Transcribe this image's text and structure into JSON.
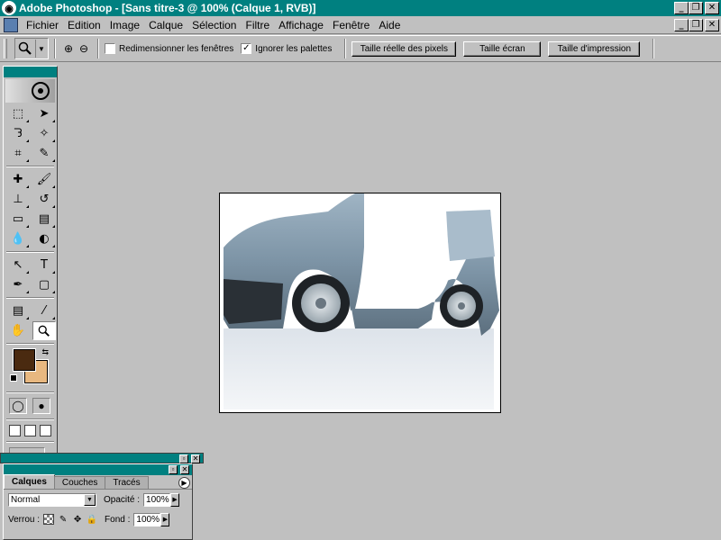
{
  "window": {
    "title": "Adobe Photoshop - [Sans titre-3 @ 100% (Calque 1, RVB)]",
    "app_icon_glyph": "◉",
    "buttons": {
      "minimize": "_",
      "restore": "❐",
      "close": "✕"
    }
  },
  "menubar": {
    "items": [
      "Fichier",
      "Edition",
      "Image",
      "Calque",
      "Sélection",
      "Filtre",
      "Affichage",
      "Fenêtre",
      "Aide"
    ]
  },
  "options": {
    "zoom_in_icon": "⊕",
    "zoom_out_icon": "⊖",
    "checkbox_resize": {
      "label": "Redimensionner les fenêtres",
      "checked": false,
      "mark": ""
    },
    "checkbox_ignore": {
      "label": "Ignorer les palettes",
      "checked": true,
      "mark": "✓"
    },
    "buttons": [
      "Taille réelle des pixels",
      "Taille écran",
      "Taille d'impression"
    ]
  },
  "toolbox": {
    "colors": {
      "foreground": "#4a2a10",
      "background": "#e8b880"
    }
  },
  "layers_palette": {
    "tabs": [
      "Calques",
      "Couches",
      "Tracés"
    ],
    "active_tab": "Calques",
    "blend_mode": "Normal",
    "opacity_label": "Opacité :",
    "opacity_value": "100%",
    "lock_label": "Verrou :",
    "fill_label": "Fond :",
    "fill_value": "100%"
  },
  "colors": {
    "titlebar": "#008080",
    "ui_gray": "#c0c0c0"
  }
}
